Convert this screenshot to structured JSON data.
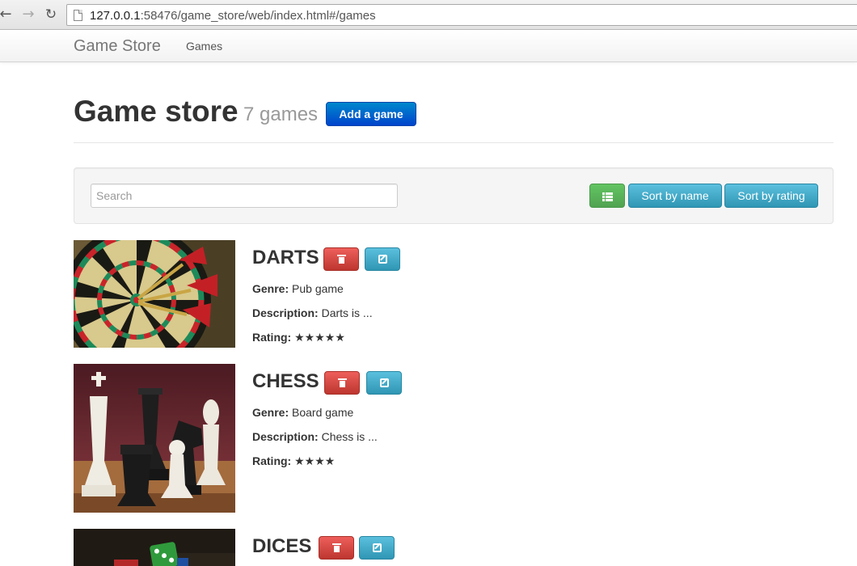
{
  "browser": {
    "url_host": "127.0.0.1",
    "url_path": ":58476/game_store/web/index.html#/games"
  },
  "navbar": {
    "brand": "Game Store",
    "links": [
      {
        "label": "Games"
      }
    ]
  },
  "header": {
    "title": "Game store",
    "count": "7 games",
    "add_button": "Add a game"
  },
  "toolbar": {
    "search_placeholder": "Search",
    "sort_by_name": "Sort by name",
    "sort_by_rating": "Sort by rating"
  },
  "labels": {
    "genre": "Genre:",
    "description": "Description:",
    "rating": "Rating:"
  },
  "games": [
    {
      "name": "DARTS",
      "genre": "Pub game",
      "description": "Darts is ...",
      "rating": 5,
      "image": "dartboard-photo"
    },
    {
      "name": "CHESS",
      "genre": "Board game",
      "description": "Chess is ...",
      "rating": 4,
      "image": "chess-pieces-photo"
    },
    {
      "name": "DICES",
      "image": "dice-photo"
    }
  ],
  "colors": {
    "primary": "#0055cc",
    "success": "#51a351",
    "info": "#2f96b4",
    "danger": "#bd362f"
  }
}
